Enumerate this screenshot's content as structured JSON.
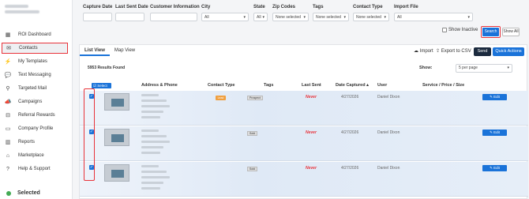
{
  "sidebar": {
    "items": [
      {
        "label": "ROI Dashboard",
        "icon": "dashboard-icon",
        "glyph": "▦"
      },
      {
        "label": "Contacts",
        "icon": "envelope-icon",
        "glyph": "✉"
      },
      {
        "label": "My Templates",
        "icon": "lightning-icon",
        "glyph": "⚡"
      },
      {
        "label": "Text Messaging",
        "icon": "chat-icon",
        "glyph": "💬"
      },
      {
        "label": "Targeted Mail",
        "icon": "location-pin-icon",
        "glyph": "⚲"
      },
      {
        "label": "Campaigns",
        "icon": "megaphone-icon",
        "glyph": "📣"
      },
      {
        "label": "Referral Rewards",
        "icon": "gift-icon",
        "glyph": "⊟"
      },
      {
        "label": "Company Profile",
        "icon": "profile-card-icon",
        "glyph": "▭"
      },
      {
        "label": "Reports",
        "icon": "bar-chart-icon",
        "glyph": "▥"
      },
      {
        "label": "Marketplace",
        "icon": "store-icon",
        "glyph": "⌂"
      },
      {
        "label": "Help & Support",
        "icon": "question-icon",
        "glyph": "?"
      }
    ],
    "footer_label": "Selected"
  },
  "filters": {
    "capture_date_label": "Capture Date",
    "last_sent_label": "Last Sent Date",
    "customer_info_label": "Customer Information",
    "city_label": "City",
    "city_value": "All",
    "state_label": "State",
    "state_value": "All",
    "zip_label": "Zip Codes",
    "zip_value": "None selected",
    "tags_label": "Tags",
    "tags_value": "None selected",
    "contact_type_label": "Contact Type",
    "contact_type_value": "None selected",
    "import_file_label": "Import File",
    "import_file_value": "All",
    "show_inactive_label": "Show Inactive",
    "search_label": "Search",
    "show_all_label": "Show All"
  },
  "panel": {
    "tabs": [
      "List View",
      "Map View"
    ],
    "import_label": "Import",
    "export_label": "Export to CSV",
    "send_label": "Send",
    "quick_actions_label": "Quick Actions",
    "results_found": "5953 Results Found",
    "show_label": "Show:",
    "per_page_value": "5 per page",
    "select_all_label": "Select All"
  },
  "table": {
    "headers": {
      "address": "Address & Phone",
      "contact_type": "Contact Type",
      "tags": "Tags",
      "last_sent": "Last Sent",
      "date_captured": "Date Captured ▴",
      "user": "User",
      "service": "Service / Price / Size"
    },
    "rows": [
      {
        "contact_type": "Lead",
        "contact_type_color": "#f0a040",
        "tag": "Prospect",
        "last_sent": "Never",
        "date": "4/27/2026",
        "user": "Daniel Dixon",
        "edit": "✎ Edit"
      },
      {
        "contact_type": "",
        "contact_type_color": "",
        "tag": "Sold",
        "last_sent": "Never",
        "date": "4/27/2026",
        "user": "Daniel Dixon",
        "edit": "✎ Edit"
      },
      {
        "contact_type": "",
        "contact_type_color": "",
        "tag": "Sold",
        "last_sent": "Never",
        "date": "4/27/2026",
        "user": "Daniel Dixon",
        "edit": "✎ Edit"
      }
    ]
  }
}
